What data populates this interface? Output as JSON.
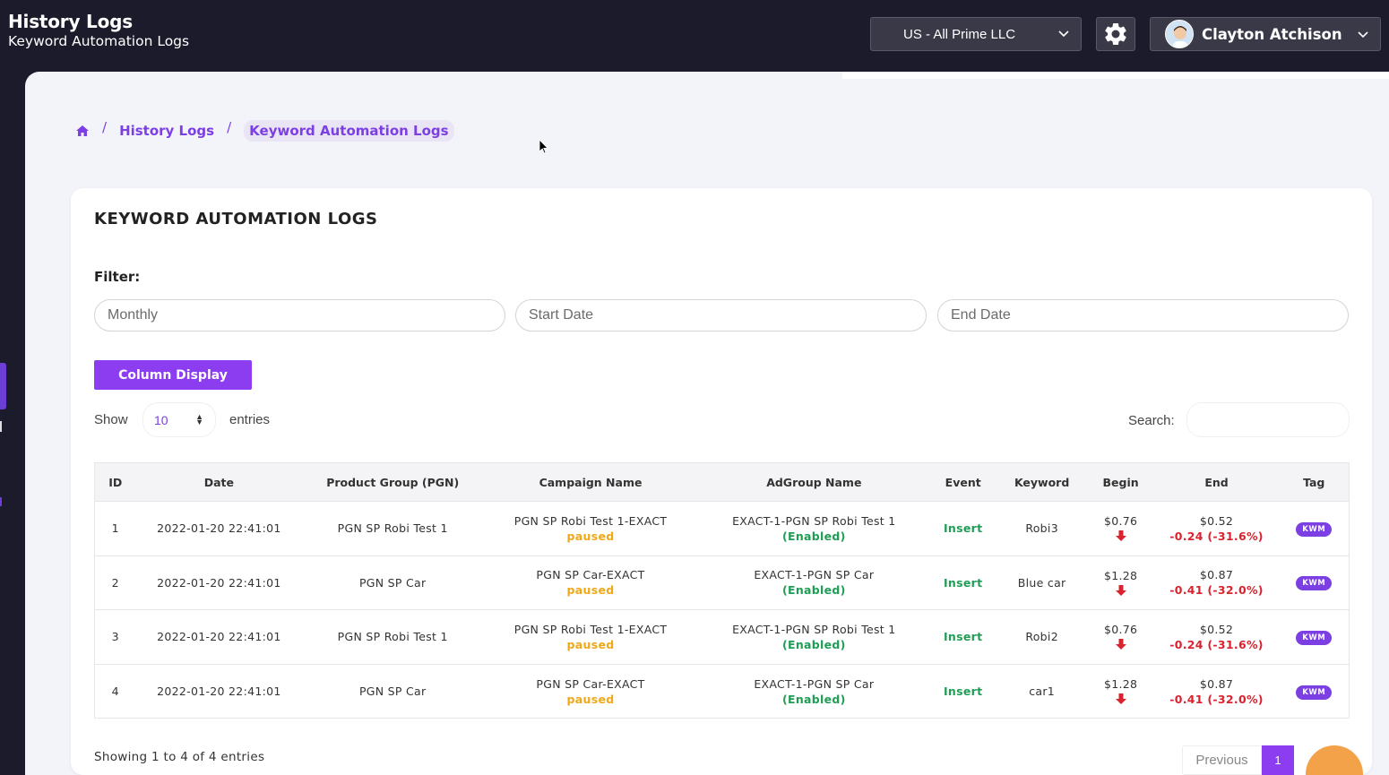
{
  "header": {
    "title": "History Logs",
    "subtitle": "Keyword Automation Logs",
    "account": "US - All Prime LLC",
    "user_name": "Clayton Atchison"
  },
  "breadcrumb": {
    "items": [
      "History Logs",
      "Keyword Automation Logs"
    ]
  },
  "card": {
    "title": "KEYWORD AUTOMATION LOGS",
    "filter_label": "Filter:",
    "filter_period_placeholder": "Monthly",
    "start_date_placeholder": "Start Date",
    "end_date_placeholder": "End Date",
    "column_display_label": "Column Display",
    "show_label": "Show",
    "entries_value": "10",
    "entries_label": "entries",
    "search_label": "Search:",
    "search_value": ""
  },
  "table": {
    "columns": [
      "ID",
      "Date",
      "Product Group (PGN)",
      "Campaign Name",
      "AdGroup Name",
      "Event",
      "Keyword",
      "Begin",
      "End",
      "Tag"
    ],
    "rows": [
      {
        "id": "1",
        "date": "2022-01-20 22:41:01",
        "pgn": "PGN SP Robi Test 1",
        "campaign": "PGN SP Robi Test 1-EXACT",
        "campaign_status": "paused",
        "adgroup": "EXACT-1-PGN SP Robi Test 1",
        "adgroup_status": "(Enabled)",
        "event": "Insert",
        "keyword": "Robi3",
        "begin": "$0.76",
        "end": "$0.52",
        "end_delta": "-0.24 (-31.6%)",
        "tag": "KWM"
      },
      {
        "id": "2",
        "date": "2022-01-20 22:41:01",
        "pgn": "PGN SP Car",
        "campaign": "PGN SP Car-EXACT",
        "campaign_status": "paused",
        "adgroup": "EXACT-1-PGN SP Car",
        "adgroup_status": "(Enabled)",
        "event": "Insert",
        "keyword": "Blue car",
        "begin": "$1.28",
        "end": "$0.87",
        "end_delta": "-0.41 (-32.0%)",
        "tag": "KWM"
      },
      {
        "id": "3",
        "date": "2022-01-20 22:41:01",
        "pgn": "PGN SP Robi Test 1",
        "campaign": "PGN SP Robi Test 1-EXACT",
        "campaign_status": "paused",
        "adgroup": "EXACT-1-PGN SP Robi Test 1",
        "adgroup_status": "(Enabled)",
        "event": "Insert",
        "keyword": "Robi2",
        "begin": "$0.76",
        "end": "$0.52",
        "end_delta": "-0.24 (-31.6%)",
        "tag": "KWM"
      },
      {
        "id": "4",
        "date": "2022-01-20 22:41:01",
        "pgn": "PGN SP Car",
        "campaign": "PGN SP Car-EXACT",
        "campaign_status": "paused",
        "adgroup": "EXACT-1-PGN SP Car",
        "adgroup_status": "(Enabled)",
        "event": "Insert",
        "keyword": "car1",
        "begin": "$1.28",
        "end": "$0.87",
        "end_delta": "-0.41 (-32.0%)",
        "tag": "KWM"
      }
    ]
  },
  "footer": {
    "showing": "Showing 1 to 4 of 4 entries",
    "previous_label": "Previous",
    "current_page": "1"
  },
  "colors": {
    "accent": "#8c3df0",
    "header_bg": "#1c1b2b",
    "paused": "#f0a818",
    "enabled": "#1f9d55",
    "decrease": "#d9232e"
  },
  "icons": {
    "home": "home-icon",
    "settings": "gear-icon",
    "dropdown": "chevron-down-icon",
    "begin_trend": "arrow-down-icon",
    "help": "help-fab-icon"
  }
}
